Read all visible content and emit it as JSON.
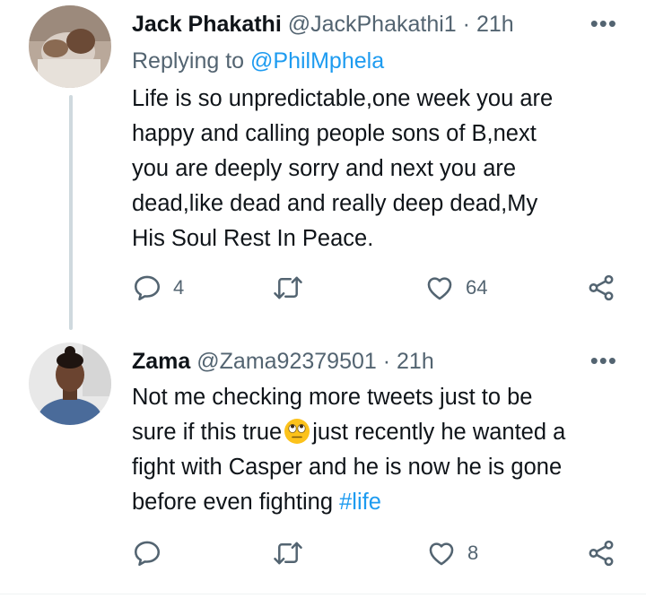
{
  "tweets": [
    {
      "name": "Jack Phakathi",
      "handle": "@JackPhakathi1",
      "separator": "·",
      "time": "21h",
      "replying_prefix": "Replying to ",
      "replying_mention": "@PhilMphela",
      "text_lines": [
        "Life is so unpredictable,one week you are",
        "happy and calling people sons of B,next",
        "you are deeply sorry and next you are",
        "dead,like dead and really deep dead,My",
        "His Soul Rest In Peace."
      ],
      "replies": "4",
      "retweets": "",
      "likes": "64",
      "more_label": "•••"
    },
    {
      "name": "Zama",
      "handle": "@Zama92379501",
      "separator": "·",
      "time": "21h",
      "text_line1_before_emoji": "Not me checking more tweets just to be",
      "text_line2_before_emoji": "sure if this true",
      "text_line2_after_emoji": "just recently he wanted a",
      "text_line3": "fight with Casper and he is now he is gone",
      "text_line4_before_hashtag": "before even fighting ",
      "hashtag": "#life",
      "emoji": "face-with-rolling-eyes",
      "replies": "",
      "retweets": "",
      "likes": "8",
      "more_label": "•••"
    }
  ],
  "colors": {
    "text": "#0f1419",
    "secondary": "#536471",
    "link": "#1d9bf0",
    "thread_line": "#cfd9de"
  }
}
